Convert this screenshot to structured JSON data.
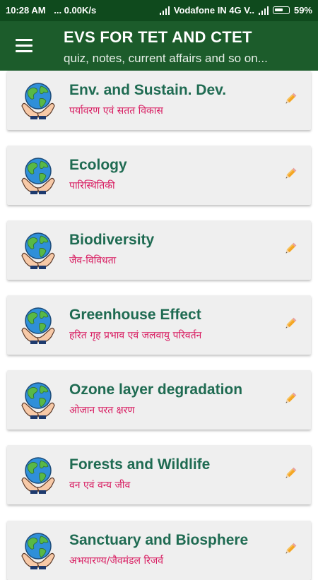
{
  "status_bar": {
    "time": "10:28 AM",
    "speed": "... 0.00K/s",
    "carrier": "Vodafone IN 4G V..",
    "battery": "59%"
  },
  "app_bar": {
    "title": "EVS FOR TET AND CTET",
    "subtitle": "quiz, notes, current affairs and so on...",
    "menu_icon": "hamburger-menu-icon",
    "color": "#1c5c2b"
  },
  "colors": {
    "title_text": "#1f6b52",
    "subtitle_text": "#d81b60",
    "card_bg": "#efefef",
    "edit_icon": "#f5a623"
  },
  "topics": [
    {
      "title": "Env. and Sustain. Dev.",
      "subtitle": "पर्यावरण एवं सतत विकास"
    },
    {
      "title": "Ecology",
      "subtitle": "पारिस्थितिकी"
    },
    {
      "title": "Biodiversity",
      "subtitle": "जैव-विविधता"
    },
    {
      "title": "Greenhouse Effect",
      "subtitle": "हरित गृह प्रभाव एवं जलवायु परिवर्तन"
    },
    {
      "title": "Ozone layer degradation",
      "subtitle": "ओजान परत क्षरण"
    },
    {
      "title": "Forests and Wildlife",
      "subtitle": "वन एवं वन्य जीव"
    },
    {
      "title": "Sanctuary and Biosphere",
      "subtitle": "अभयारण्य/जैवमंडल रिजर्व"
    }
  ]
}
